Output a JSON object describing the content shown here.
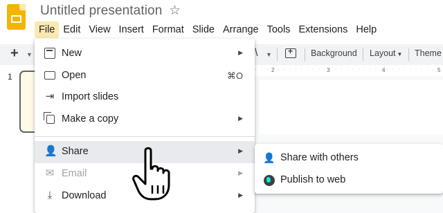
{
  "app": {
    "title": "Untitled presentation",
    "icon": "slides-app-icon"
  },
  "menubar": [
    "File",
    "Edit",
    "View",
    "Insert",
    "Format",
    "Slide",
    "Arrange",
    "Tools",
    "Extensions",
    "Help"
  ],
  "toolbar": {
    "add": "+",
    "background_label": "Background",
    "layout_label": "Layout",
    "theme_label": "Theme"
  },
  "slide_panel": {
    "slide_number": "1"
  },
  "ruler": {
    "ticks": [
      "2",
      "3",
      "4",
      "5"
    ]
  },
  "file_menu": {
    "items": [
      {
        "label": "New",
        "icon": "new-slide-icon",
        "has_submenu": true
      },
      {
        "label": "Open",
        "icon": "folder-icon",
        "shortcut": "⌘O"
      },
      {
        "label": "Import slides",
        "icon": "import-icon"
      },
      {
        "label": "Make a copy",
        "icon": "copy-icon",
        "has_submenu": true
      },
      {
        "label": "Share",
        "icon": "add-person-icon",
        "has_submenu": true,
        "highlighted": true
      },
      {
        "label": "Email",
        "icon": "email-icon",
        "has_submenu": true,
        "disabled": true
      },
      {
        "label": "Download",
        "icon": "download-icon",
        "has_submenu": true
      }
    ]
  },
  "share_submenu": {
    "items": [
      {
        "label": "Share with others",
        "icon": "add-person-icon"
      },
      {
        "label": "Publish to web",
        "icon": "globe-icon",
        "highlighted": true
      }
    ]
  },
  "colors": {
    "active_menu_bg": "#fce8b2",
    "hover_bg": "#e8eaed",
    "highlight": "#00f2d8",
    "app_icon": "#f4b400"
  }
}
